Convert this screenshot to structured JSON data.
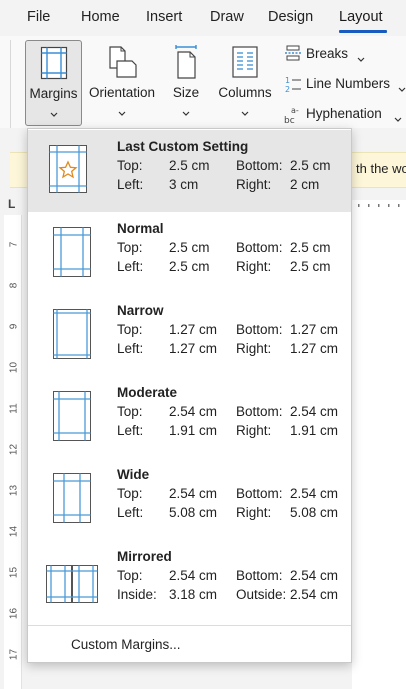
{
  "menubar": {
    "tabs": [
      {
        "label": "File"
      },
      {
        "label": "Home"
      },
      {
        "label": "Insert"
      },
      {
        "label": "Draw"
      },
      {
        "label": "Design"
      },
      {
        "label": "Layout",
        "active": true
      }
    ]
  },
  "ribbon": {
    "buttons": [
      {
        "label": "Margins",
        "icon": "margins-icon"
      },
      {
        "label": "Orientation",
        "icon": "orientation-icon"
      },
      {
        "label": "Size",
        "icon": "size-icon"
      },
      {
        "label": "Columns",
        "icon": "columns-icon"
      }
    ],
    "small_commands": [
      {
        "label": "Breaks",
        "icon": "breaks-icon"
      },
      {
        "label": "Line Numbers",
        "icon": "line-numbers-icon"
      },
      {
        "label": "Hyphenation",
        "icon": "hyphenation-icon"
      }
    ]
  },
  "document": {
    "banner_text": "th the wo",
    "ruler_corner": "L",
    "ruler_numbers": [
      "7",
      "8",
      "9",
      "10",
      "11",
      "12",
      "13",
      "14",
      "15",
      "16",
      "17"
    ]
  },
  "margins_menu": {
    "options": [
      {
        "title": "Last Custom Setting",
        "label1": "Top:",
        "value1": "2.5 cm",
        "label2": "Bottom:",
        "value2": "2.5 cm",
        "label3": "Left:",
        "value3": "3 cm",
        "label4": "Right:",
        "value4": "2 cm",
        "selected": true,
        "icon": "custom-margin-star-icon"
      },
      {
        "title": "Normal",
        "label1": "Top:",
        "value1": "2.5 cm",
        "label2": "Bottom:",
        "value2": "2.5 cm",
        "label3": "Left:",
        "value3": "2.5 cm",
        "label4": "Right:",
        "value4": "2.5 cm",
        "icon": "normal-margin-icon"
      },
      {
        "title": "Narrow",
        "label1": "Top:",
        "value1": "1.27 cm",
        "label2": "Bottom:",
        "value2": "1.27 cm",
        "label3": "Left:",
        "value3": "1.27 cm",
        "label4": "Right:",
        "value4": "1.27 cm",
        "icon": "narrow-margin-icon"
      },
      {
        "title": "Moderate",
        "label1": "Top:",
        "value1": "2.54 cm",
        "label2": "Bottom:",
        "value2": "2.54 cm",
        "label3": "Left:",
        "value3": "1.91 cm",
        "label4": "Right:",
        "value4": "1.91 cm",
        "icon": "moderate-margin-icon"
      },
      {
        "title": "Wide",
        "label1": "Top:",
        "value1": "2.54 cm",
        "label2": "Bottom:",
        "value2": "2.54 cm",
        "label3": "Left:",
        "value3": "5.08 cm",
        "label4": "Right:",
        "value4": "5.08 cm",
        "icon": "wide-margin-icon"
      },
      {
        "title": "Mirrored",
        "label1": "Top:",
        "value1": "2.54 cm",
        "label2": "Bottom:",
        "value2": "2.54 cm",
        "label3": "Inside:",
        "value3": "3.18 cm",
        "label4": "Outside:",
        "value4": "2.54 cm",
        "icon": "mirrored-margin-icon"
      }
    ],
    "custom_margins_label": "Custom Margins..."
  },
  "colors": {
    "accent": "#185abd",
    "margin_line": "#4a9bd8",
    "selected_bg": "#e6e6e6",
    "star": "#e08a1e"
  }
}
